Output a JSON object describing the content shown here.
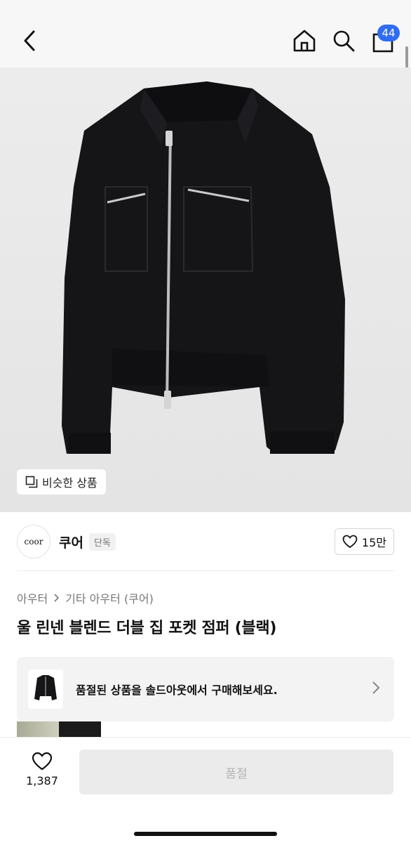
{
  "header": {
    "cart_count": "44",
    "icons": [
      "back-icon",
      "home-icon",
      "search-icon",
      "cart-icon"
    ]
  },
  "hero": {
    "similar_label": "비슷한 상품"
  },
  "brand": {
    "logo_text": "coor",
    "name": "쿠어",
    "tag": "단독",
    "likes": "15만"
  },
  "product": {
    "breadcrumb": [
      "아우터",
      "기타 아우터 (쿠어)"
    ],
    "title": "울 린넨 블렌드 더블 집 포켓 점퍼 (블랙)"
  },
  "soldout_banner": {
    "text": "품절된 상품을 솔드아웃에서 구매해보세요."
  },
  "bottom": {
    "wish_count": "1,387",
    "buy_label": "품절"
  },
  "colors": {
    "badge": "#2f6cf0",
    "jacket": "#151518",
    "zipper": "#c9c9c9",
    "disabled_btn": "#ebebeb",
    "disabled_text": "#b4b4b4"
  }
}
